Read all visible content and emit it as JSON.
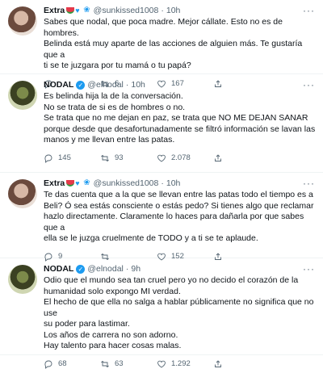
{
  "tweets": [
    {
      "name": "Extra",
      "handle": "@sunkissed1008",
      "time": "10h",
      "lines": [
        "Sabes que nodal, que poca madre. Mejor cállate. Esto no es de hombres.",
        "Belinda está muy aparte de las acciones de alguien más. Te gustaría que a",
        "ti se te juzgara por tu mamá o tu papá?"
      ],
      "replies": "",
      "retweets": "6",
      "likes": "167"
    },
    {
      "name": "NODAL",
      "handle": "@elnodal",
      "time": "10h",
      "lines": [
        "Es belinda hija la de la conversación.",
        "No se trata de si es de hombres o no.",
        "Se trata que no me dejan en paz, se trata que NO ME DEJAN  SANAR",
        "porque desde que desafortunadamente se filtró información se lavan las",
        "manos y me llevan entre las patas."
      ],
      "replies": "145",
      "retweets": "93",
      "likes": "2.078"
    },
    {
      "name": "Extra",
      "handle": "@sunkissed1008",
      "time": "10h",
      "lines": [
        "Te das cuenta que a la que se llevan entre las patas todo el tiempo es a",
        "Beli? Ó sea estás consciente o estás pedo? Si tienes algo que reclamar",
        "hazlo directamente. Claramente lo haces para dañarla por que sabes que a",
        "ella se le juzga cruelmente de TODO y a ti se te aplaude."
      ],
      "replies": "9",
      "retweets": "",
      "likes": "152"
    },
    {
      "name": "NODAL",
      "handle": "@elnodal",
      "time": "9h",
      "lines": [
        "Odio que el mundo sea tan cruel pero yo no decido el corazón de la",
        "humanidad solo expongo MI verdad.",
        "El hecho de que ella no salga a hablar públicamente no significa que no use",
        "su poder para lastimar.",
        "Los años de carrera no son adorno.",
        "Hay talento para hacer cosas malas."
      ],
      "replies": "68",
      "retweets": "63",
      "likes": "1.292"
    }
  ],
  "ui": {
    "more": "···",
    "verified": "✓",
    "dot": "·"
  }
}
